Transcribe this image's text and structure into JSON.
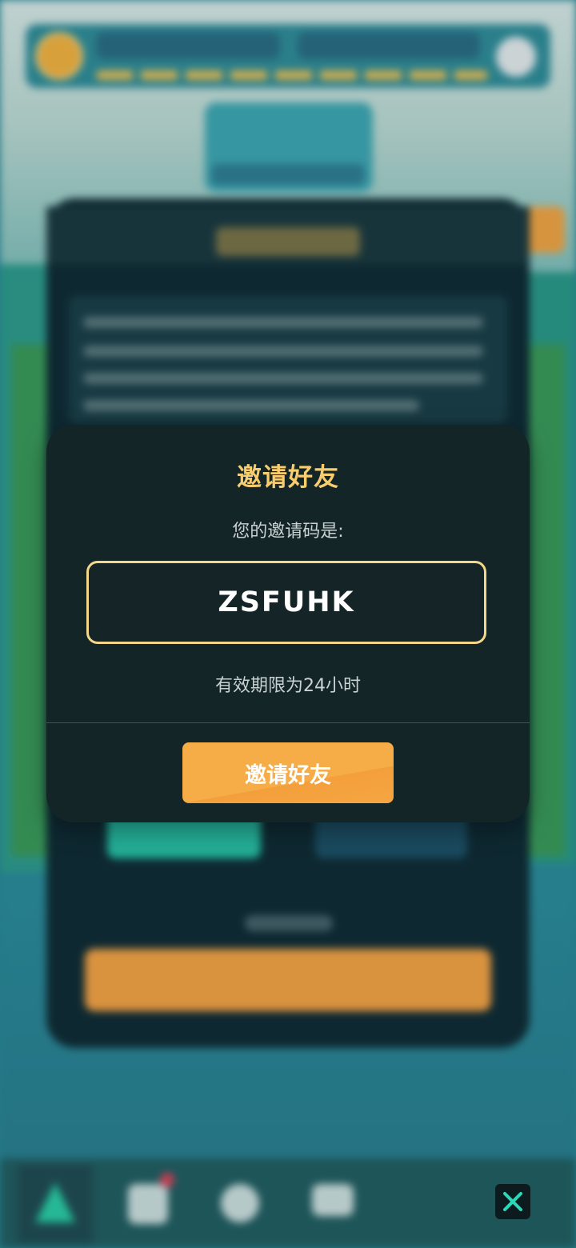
{
  "modal": {
    "title": "邀请好友",
    "code_label": "您的邀请码是:",
    "invite_code": "ZSFUHK",
    "validity": "有效期限为24小时",
    "invite_button_label": "邀请好友"
  },
  "close_button": {
    "icon": "close-icon"
  },
  "colors": {
    "accent_gold": "#f9cd6d",
    "button_orange": "#f7ad47",
    "modal_bg": "#142528",
    "close_icon": "#29d9b8"
  },
  "background": {
    "description_state": "blurred",
    "bottom_nav_icons": [
      "triangle-icon",
      "pet-icon",
      "compass-icon",
      "heart-icon"
    ]
  }
}
